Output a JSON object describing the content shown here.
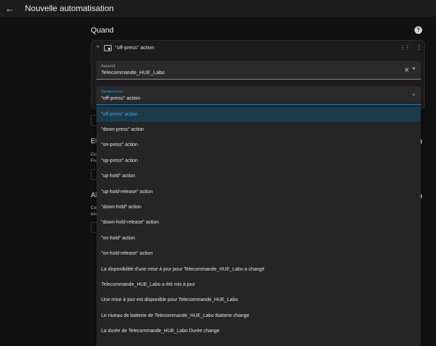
{
  "app": {
    "title": "Nouvelle automatisation"
  },
  "section": {
    "title": "Quand"
  },
  "card": {
    "title": "\"off-press\" action"
  },
  "device_field": {
    "label": "Appareil",
    "value": "Telecommande_HUE_Labo"
  },
  "trigger_field": {
    "label": "Déclencheur",
    "value": "\"off-press\" action"
  },
  "background": {
    "section2_title": "Et",
    "section2_line1": "Co",
    "section2_line2": "Fre",
    "section3_title": "Al",
    "section3_line1": "Ce",
    "section3_line2": "exé"
  },
  "dropdown": {
    "options": [
      "\"off-press\" action",
      "\"down-press\" action",
      "\"on-press\" action",
      "\"up-press\" action",
      "\"up-hold\" action",
      "\"up-hold-release\" action",
      "\"down-hold\" action",
      "\"down-hold-release\" action",
      "\"on-hold\" action",
      "\"on-hold-release\" action",
      "La disponibilité d'une mise à jour pour Telecommande_HUE_Labo a changé",
      "Telecommande_HUE_Labo a été mis à jour",
      "Une mise à jour est disponible pour Telecommande_HUE_Labo",
      "Le niveau de batterie de Telecommande_HUE_Labo Batterie change",
      "La durée de Telecommande_HUE_Labo Durée change"
    ],
    "selected_index": 0
  },
  "colors": {
    "accent": "#03a9f4",
    "background": "#111111",
    "card": "#1c1c1c"
  },
  "icons": {
    "back": "arrow-left-icon",
    "help": "help-circle-icon",
    "chevron": "chevron-up-icon",
    "device": "device-icon",
    "drag": "drag-handle-icon",
    "menu": "dots-vertical-icon",
    "clear": "close-icon",
    "caret_down": "caret-down-icon",
    "caret_up": "caret-up-icon"
  }
}
